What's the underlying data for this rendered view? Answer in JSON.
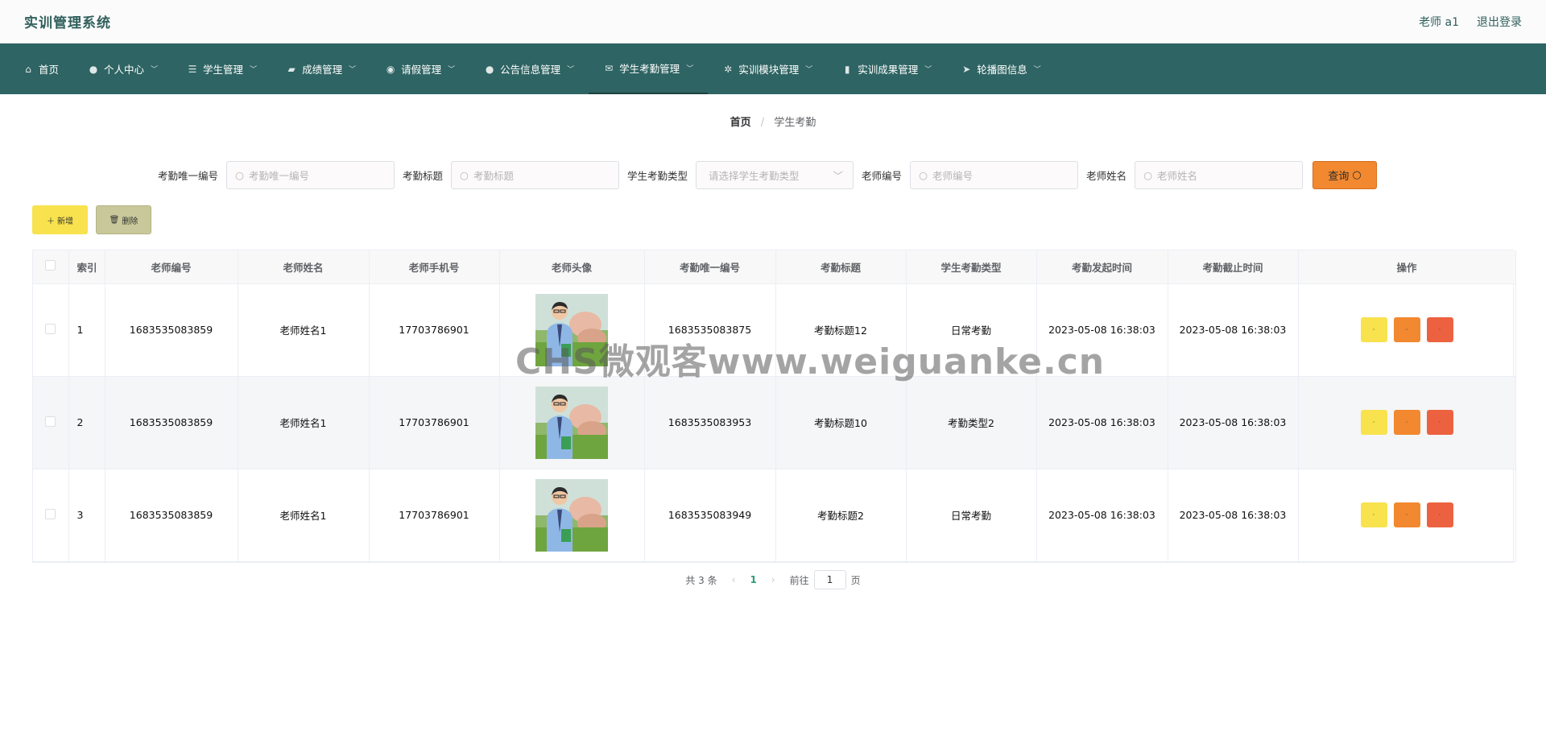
{
  "app": {
    "title": "实训管理系统",
    "user": "老师 a1",
    "logout": "退出登录"
  },
  "nav": [
    {
      "label": "首页",
      "icon": "home-icon",
      "glyph": "⌂",
      "chev": false
    },
    {
      "label": "个人中心",
      "icon": "user-icon",
      "glyph": "●",
      "chev": true
    },
    {
      "label": "学生管理",
      "icon": "list-icon",
      "glyph": "☰",
      "chev": true
    },
    {
      "label": "成绩管理",
      "icon": "folder-icon",
      "glyph": "▰",
      "chev": true
    },
    {
      "label": "请假管理",
      "icon": "location-icon",
      "glyph": "◉",
      "chev": true
    },
    {
      "label": "公告信息管理",
      "icon": "user-icon",
      "glyph": "●",
      "chev": true
    },
    {
      "label": "学生考勤管理",
      "icon": "mail-icon",
      "glyph": "✉",
      "chev": true,
      "active": true
    },
    {
      "label": "实训模块管理",
      "icon": "compass-icon",
      "glyph": "✲",
      "chev": true
    },
    {
      "label": "实训成果管理",
      "icon": "chart-icon",
      "glyph": "▮",
      "chev": true
    },
    {
      "label": "轮播图信息",
      "icon": "send-icon",
      "glyph": "➤",
      "chev": true
    }
  ],
  "breadcrumb": {
    "home": "首页",
    "current": "学生考勤"
  },
  "search": {
    "kaoqin_id_label": "考勤唯一编号",
    "kaoqin_id_placeholder": "考勤唯一编号",
    "title_label": "考勤标题",
    "title_placeholder": "考勤标题",
    "type_label": "学生考勤类型",
    "type_placeholder": "请选择学生考勤类型",
    "teacher_no_label": "老师编号",
    "teacher_no_placeholder": "老师编号",
    "teacher_name_label": "老师姓名",
    "teacher_name_placeholder": "老师姓名",
    "query_button": "查询"
  },
  "actions": {
    "add": "新增",
    "delete": "删除"
  },
  "table": {
    "headers": [
      "索引",
      "老师编号",
      "老师姓名",
      "老师手机号",
      "老师头像",
      "考勤唯一编号",
      "考勤标题",
      "学生考勤类型",
      "考勤发起时间",
      "考勤截止时间",
      "操作"
    ],
    "rows": [
      {
        "index": "1",
        "teacher_no": "1683535083859",
        "teacher_name": "老师姓名1",
        "phone": "17703786901",
        "kaoqin_id": "1683535083875",
        "title": "考勤标题12",
        "type": "日常考勤",
        "start": "2023-05-08 16:38:03",
        "end": "2023-05-08 16:38:03"
      },
      {
        "index": "2",
        "teacher_no": "1683535083859",
        "teacher_name": "老师姓名1",
        "phone": "17703786901",
        "kaoqin_id": "1683535083953",
        "title": "考勤标题10",
        "type": "考勤类型2",
        "start": "2023-05-08 16:38:03",
        "end": "2023-05-08 16:38:03"
      },
      {
        "index": "3",
        "teacher_no": "1683535083859",
        "teacher_name": "老师姓名1",
        "phone": "17703786901",
        "kaoqin_id": "1683535083949",
        "title": "考勤标题2",
        "type": "日常考勤",
        "start": "2023-05-08 16:38:03",
        "end": "2023-05-08 16:38:03"
      }
    ],
    "op_labels": [
      "·",
      "·",
      "·"
    ]
  },
  "pagination": {
    "total": "共 3 条",
    "page": "1",
    "goto_prefix": "前往",
    "goto_value": "1",
    "goto_suffix": "页"
  },
  "watermark": "CHS微观客www.weiguanke.cn"
}
